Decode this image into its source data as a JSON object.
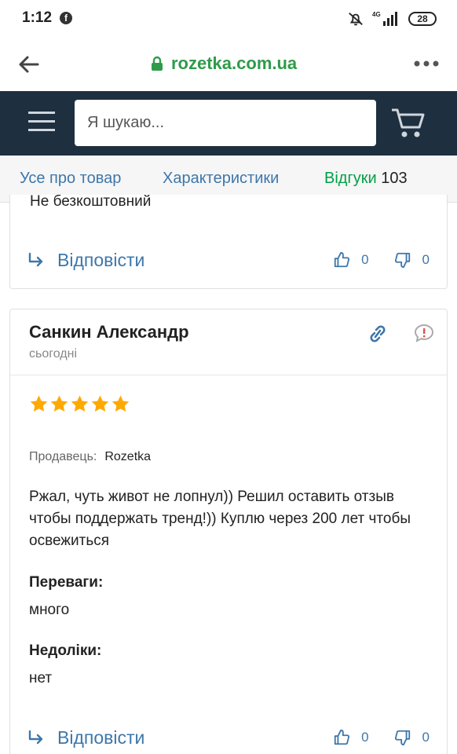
{
  "status_bar": {
    "time": "1:12",
    "battery": "28",
    "network": "4G"
  },
  "browser": {
    "url": "rozetka.com.ua"
  },
  "header": {
    "search_placeholder": "Я шукаю..."
  },
  "tabs": [
    {
      "label": "Усе про товар"
    },
    {
      "label": "Характеристики"
    },
    {
      "label": "Відгуки",
      "count": "103"
    }
  ],
  "previous_review": {
    "text_fragment": "Не безкоштовний",
    "reply_label": "Відповісти",
    "likes": "0",
    "dislikes": "0"
  },
  "review": {
    "author": "Санкин Александр",
    "date": "сьогодні",
    "rating": 5,
    "seller_label": "Продавець:",
    "seller_value": "Rozetka",
    "comment": "Ржал, чуть живот не лопнул)) Решил оставить отзыв чтобы поддержать тренд!)) Куплю через 200 лет чтобы освежиться",
    "pros_label": "Переваги:",
    "pros_value": "много",
    "cons_label": "Недоліки:",
    "cons_value": "нет",
    "reply_label": "Відповісти",
    "likes": "0",
    "dislikes": "0"
  },
  "colors": {
    "header_bg": "#1e2f3f",
    "accent_green": "#00a046",
    "link_blue": "#3e77aa",
    "star": "#ffa900"
  },
  "icons": [
    "facebook-icon",
    "bell-off-icon",
    "signal-icon",
    "battery-icon",
    "back-arrow-icon",
    "lock-icon",
    "more-icon",
    "menu-icon",
    "cart-icon",
    "reply-arrow-icon",
    "thumbs-up-icon",
    "thumbs-down-icon",
    "link-icon",
    "complain-icon",
    "star-icon"
  ]
}
